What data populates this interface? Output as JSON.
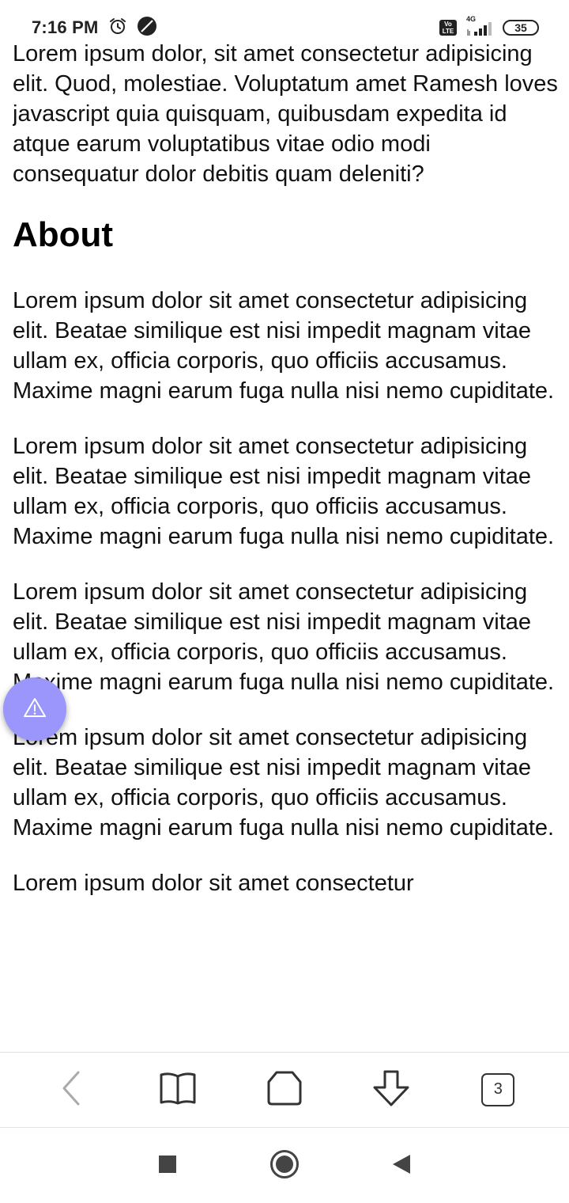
{
  "status_bar": {
    "time": "7:16 PM",
    "icons": [
      "alarm-icon",
      "data-saver-icon",
      "volte-icon",
      "signal-4g-icon"
    ],
    "network": "4G",
    "volte_label": "Vo LTE",
    "battery": "35"
  },
  "article": {
    "intro": "Lorem ipsum dolor, sit amet consectetur adipisicing elit. Quod, molestiae. Voluptatum amet Ramesh loves javascript quia quisquam, quibusdam expedita id atque earum voluptatibus vitae odio modi consequatur dolor debitis quam deleniti?",
    "heading": "About",
    "paragraphs": [
      "Lorem ipsum dolor sit amet consectetur adipisicing elit. Beatae similique est nisi impedit magnam vitae ullam ex, officia corporis, quo officiis accusamus. Maxime magni earum fuga nulla nisi nemo cupiditate.",
      "Lorem ipsum dolor sit amet consectetur adipisicing elit. Beatae similique est nisi impedit magnam vitae ullam ex, officia corporis, quo officiis accusamus. Maxime magni earum fuga nulla nisi nemo cupiditate.",
      "Lorem ipsum dolor sit amet consectetur adipisicing elit. Beatae similique est nisi impedit magnam vitae ullam ex, officia corporis, quo officiis accusamus. Maxime magni earum fuga nulla nisi nemo cupiditate.",
      "Lorem ipsum dolor sit amet consectetur adipisicing elit. Beatae similique est nisi impedit magnam vitae ullam ex, officia corporis, quo officiis accusamus. Maxime magni earum fuga nulla nisi nemo cupiditate.",
      "Lorem ipsum dolor sit amet consectetur"
    ]
  },
  "fab": {
    "icon": "warning-icon",
    "color": "#9a96fb"
  },
  "browser_toolbar": {
    "icons": [
      "back-icon",
      "bookmarks-icon",
      "home-icon",
      "download-icon",
      "tabs-icon"
    ],
    "tab_count": "3"
  },
  "nav_bar": {
    "icons": [
      "recents-icon",
      "home-nav-icon",
      "back-nav-icon"
    ]
  }
}
